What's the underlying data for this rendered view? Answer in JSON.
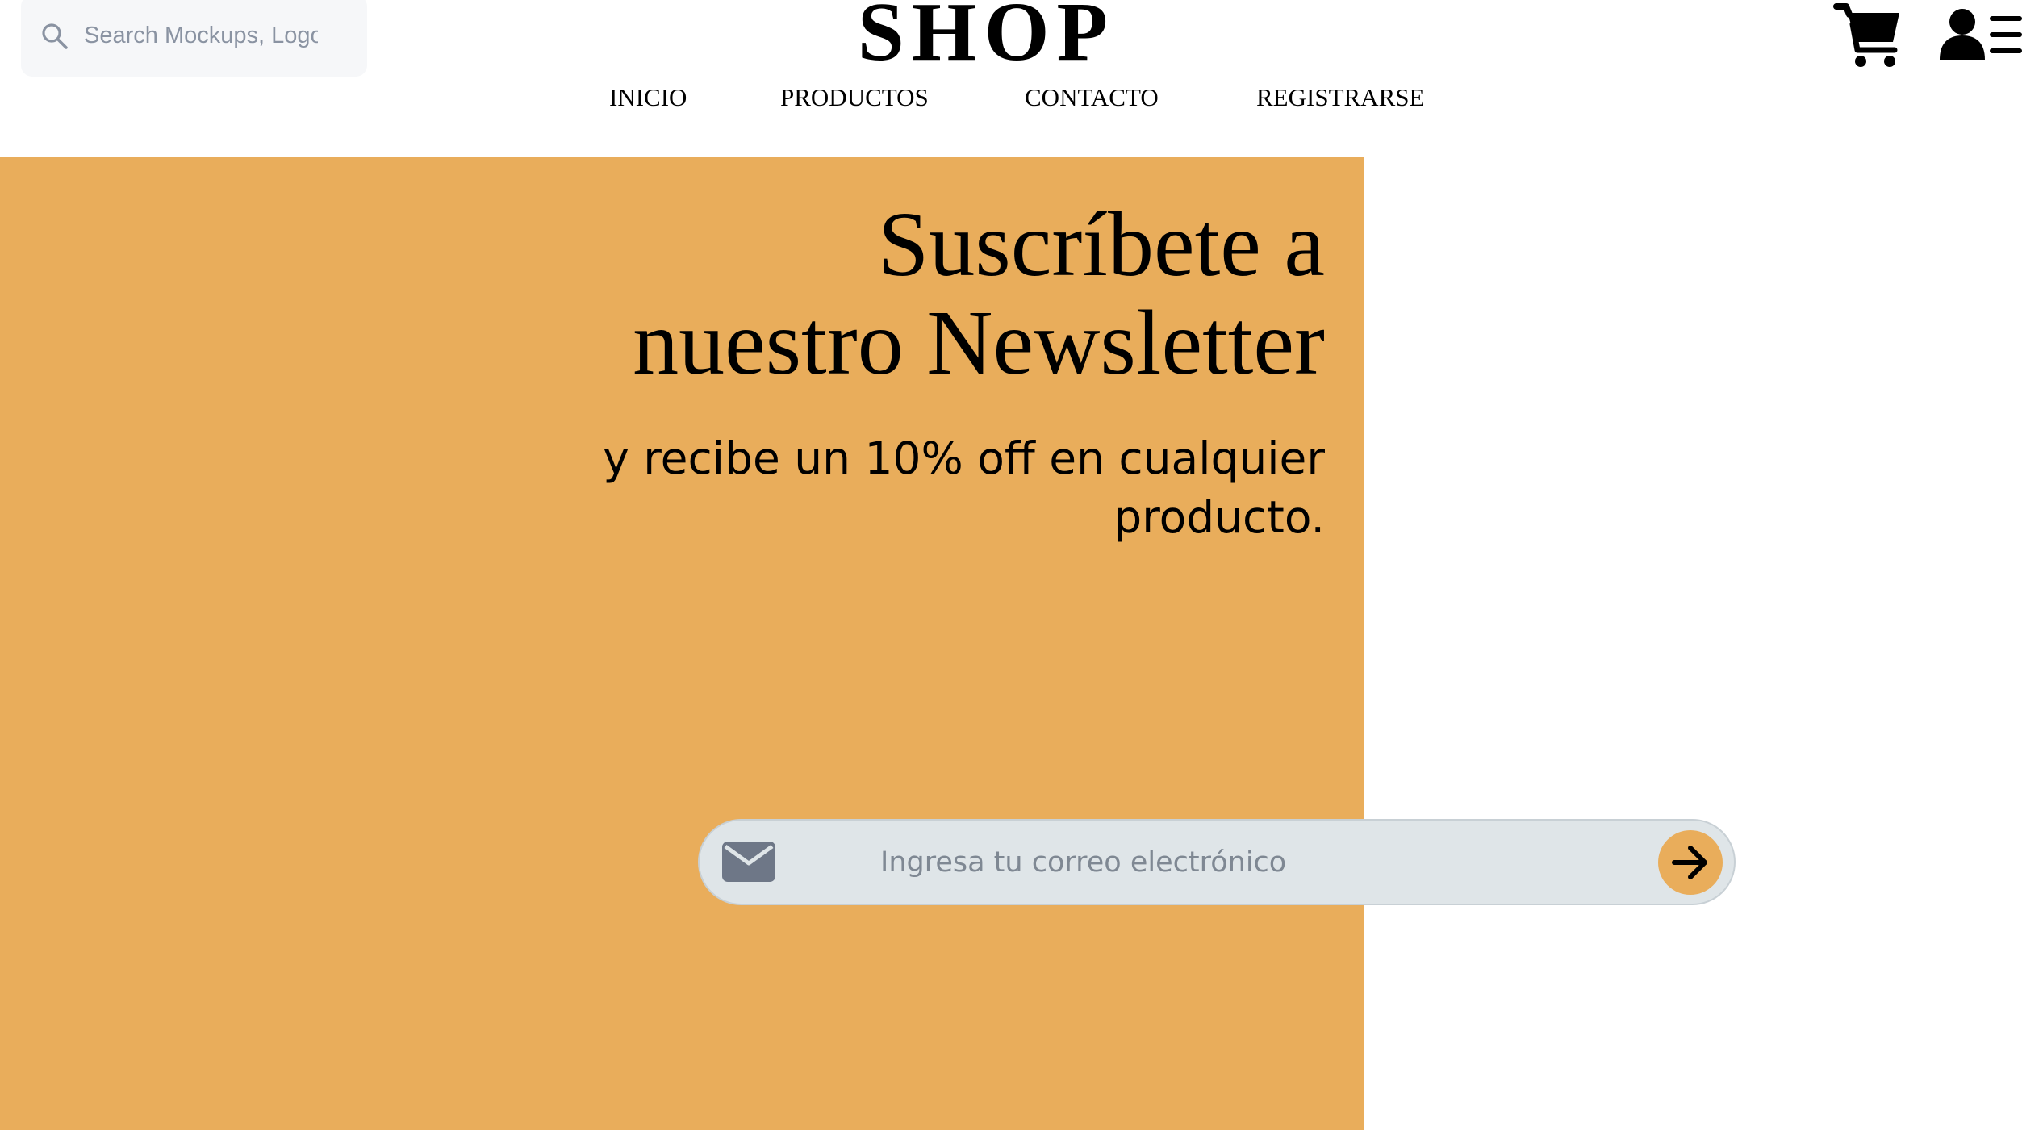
{
  "search": {
    "placeholder": "Search Mockups, Logos...",
    "icon": "search-icon"
  },
  "brand": {
    "logo_text": "SHOP"
  },
  "nav": {
    "items": [
      {
        "label": "INICIO"
      },
      {
        "label": "PRODUCTOS"
      },
      {
        "label": "CONTACTO"
      },
      {
        "label": "REGISTRARSE"
      }
    ]
  },
  "header_actions": {
    "cart_icon": "shopping-cart-icon",
    "user_icon": "user-menu-icon"
  },
  "newsletter": {
    "title_line1": "Suscríbete a",
    "title_line2": "nuestro Newsletter",
    "subtitle": "y recibe un 10% off en cualquier producto.",
    "email_placeholder": "Ingresa tu correo electrónico",
    "email_icon": "envelope-icon",
    "submit_icon": "arrow-right-icon"
  },
  "colors": {
    "accent": "#e9ad5b",
    "input_bg": "#dfe5e8",
    "text": "#000000"
  }
}
